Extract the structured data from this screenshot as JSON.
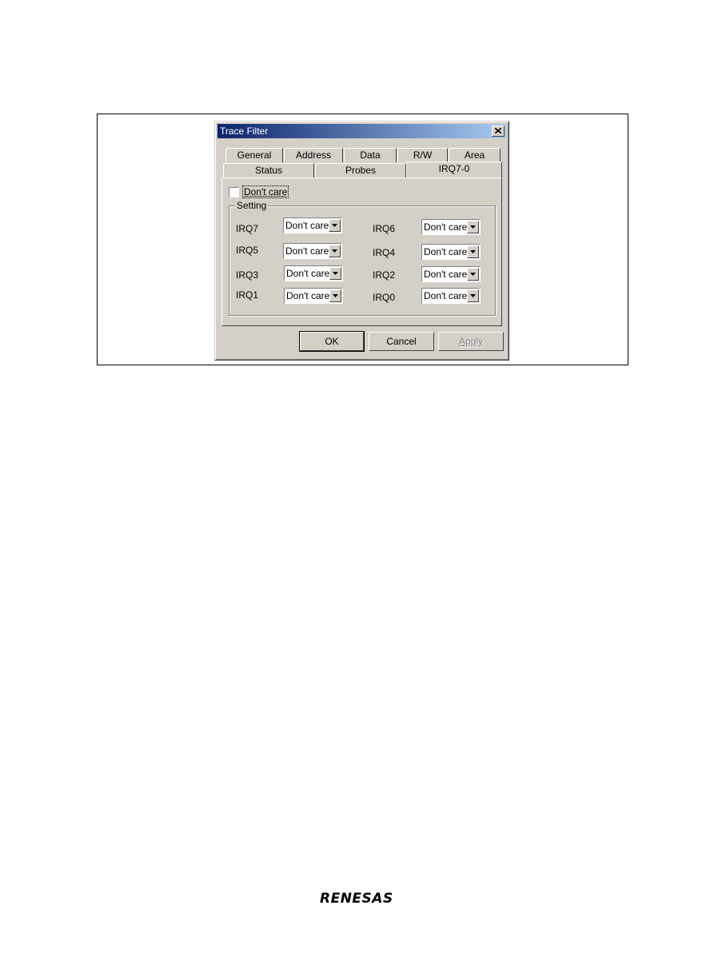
{
  "dialog": {
    "title": "Trace Filter",
    "tabs_row1": [
      "General",
      "Address",
      "Data",
      "R/W",
      "Area"
    ],
    "tabs_row2": [
      "Status",
      "Probes",
      "IRQ7-0"
    ],
    "active_tab": "IRQ7-0",
    "dont_care_checkbox": {
      "label": "Don't care",
      "checked": false
    },
    "setting_group": {
      "title": "Setting",
      "irqs": [
        {
          "label": "IRQ7",
          "value": "Don't care"
        },
        {
          "label": "IRQ6",
          "value": "Don't care"
        },
        {
          "label": "IRQ5",
          "value": "Don't care"
        },
        {
          "label": "IRQ4",
          "value": "Don't care"
        },
        {
          "label": "IRQ3",
          "value": "Don't care"
        },
        {
          "label": "IRQ2",
          "value": "Don't care"
        },
        {
          "label": "IRQ1",
          "value": "Don't care"
        },
        {
          "label": "IRQ0",
          "value": "Don't care"
        }
      ]
    },
    "buttons": {
      "ok": "OK",
      "cancel": "Cancel",
      "apply": "Apply"
    }
  },
  "footer": {
    "logo_text": "RENESAS"
  },
  "colors": {
    "dialog_face": "#d4d0c8",
    "titlebar_start": "#0a246a",
    "titlebar_end": "#a6caf0"
  }
}
